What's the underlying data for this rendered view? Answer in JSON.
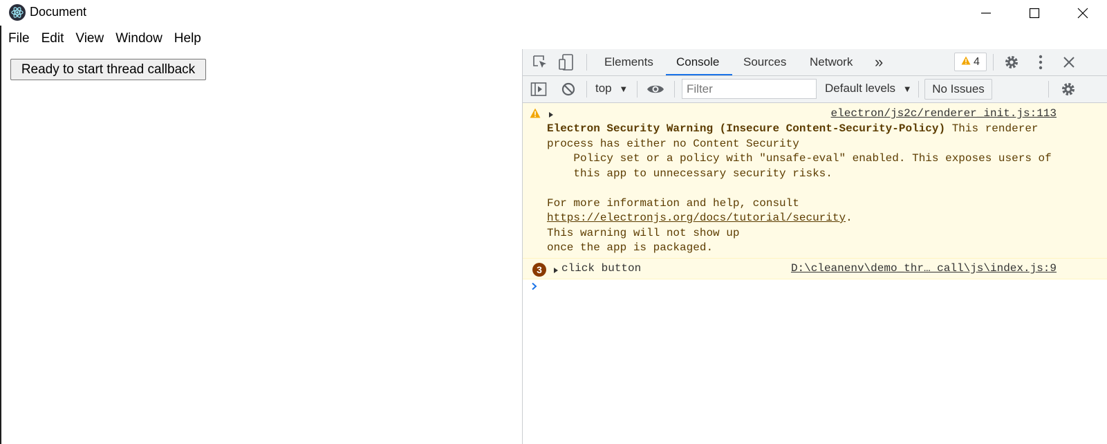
{
  "window": {
    "title": "Document",
    "icons": {
      "app": "electron-icon",
      "minimize": "minimize-icon",
      "maximize": "maximize-icon",
      "close": "close-icon"
    }
  },
  "menu": {
    "items": [
      "File",
      "Edit",
      "View",
      "Window",
      "Help"
    ]
  },
  "page": {
    "button_label": "Ready to start thread callback"
  },
  "devtools": {
    "tabs": [
      "Elements",
      "Console",
      "Sources",
      "Network"
    ],
    "active_tab": "Console",
    "more_tabs_label": "»",
    "warnings_count": "4",
    "filterbar": {
      "context": "top",
      "filter_placeholder": "Filter",
      "levels": "Default levels",
      "issues": "No Issues"
    },
    "console": {
      "warning": {
        "source": "electron/js2c/renderer_init.js:113",
        "title": "Electron Security Warning (Insecure Content-Security-Policy)",
        "line1_rest": " This renderer",
        "line2": "process has either no Content Security",
        "line3": "    Policy set or a policy with \"unsafe-eval\" enabled. This exposes users of",
        "line4": "    this app to unnecessary security risks.",
        "line5": "For more information and help, consult",
        "link": "https://electronjs.org/docs/tutorial/security",
        "link_after": ".",
        "line7": "This warning will not show up",
        "line8": "once the app is packaged."
      },
      "log": {
        "count": "3",
        "text": "click button",
        "source": "D:\\cleanenv\\demo_thr… call\\js\\index.js:9"
      }
    },
    "colors": {
      "accent": "#1a73e8",
      "warning_bg": "#fffbe5",
      "warning_icon": "#f2a600",
      "badge": "#8a3a00"
    }
  }
}
